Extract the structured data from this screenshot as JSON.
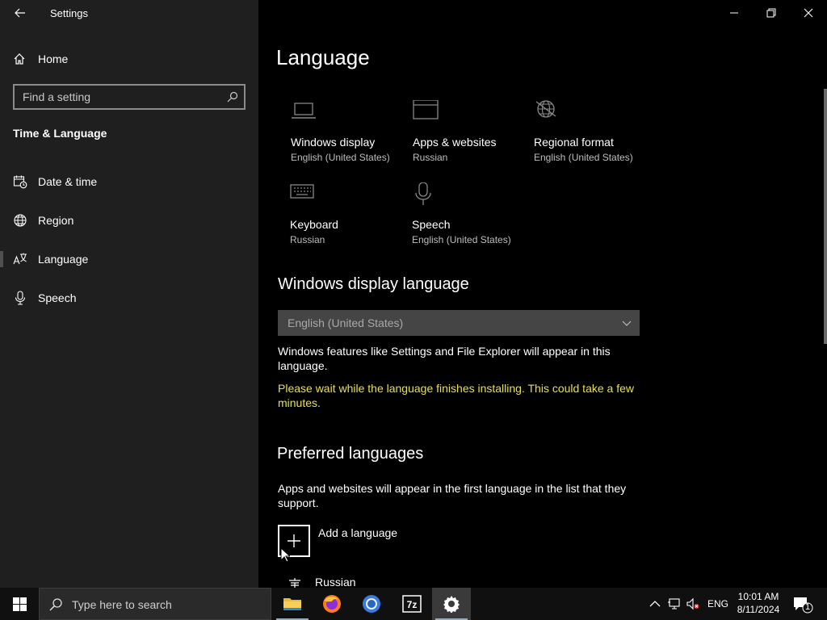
{
  "window": {
    "title": "Settings"
  },
  "sidebar": {
    "home_label": "Home",
    "search_placeholder": "Find a setting",
    "section_title": "Time & Language",
    "items": [
      {
        "label": "Date & time",
        "icon": "calendar-clock-icon"
      },
      {
        "label": "Region",
        "icon": "globe-icon"
      },
      {
        "label": "Language",
        "icon": "language-icon",
        "selected": true
      },
      {
        "label": "Speech",
        "icon": "microphone-icon"
      }
    ]
  },
  "main": {
    "title": "Language",
    "tiles": [
      {
        "name": "Windows display",
        "value": "English (United States)",
        "icon": "laptop-icon"
      },
      {
        "name": "Apps & websites",
        "value": "Russian",
        "icon": "browser-window-icon"
      },
      {
        "name": "Regional format",
        "value": "English (United States)",
        "icon": "regional-globe-icon"
      },
      {
        "name": "Keyboard",
        "value": "Russian",
        "icon": "keyboard-icon"
      },
      {
        "name": "Speech",
        "value": "English (United States)",
        "icon": "microphone-icon"
      }
    ],
    "display_language": {
      "heading": "Windows display language",
      "selected": "English (United States)",
      "description": "Windows features like Settings and File Explorer will appear in this language.",
      "warning": "Please wait while the language finishes installing. This could take a few minutes.",
      "warning_color": "#e8e04a"
    },
    "preferred": {
      "heading": "Preferred languages",
      "description": "Apps and websites will appear in the first language in the list that they support.",
      "add_label": "Add a language",
      "languages": [
        "Russian"
      ]
    }
  },
  "taskbar": {
    "search_placeholder": "Type here to search",
    "apps": [
      {
        "name": "File Explorer",
        "icon": "folder-icon"
      },
      {
        "name": "Firefox",
        "icon": "firefox-icon"
      },
      {
        "name": "Chromium",
        "icon": "chromium-icon"
      },
      {
        "name": "7-Zip",
        "icon": "7zip-icon",
        "text": "7z"
      },
      {
        "name": "Settings",
        "icon": "gear-icon",
        "active": true
      }
    ],
    "tray": {
      "language": "ENG",
      "time": "10:01 AM",
      "date": "8/11/2024",
      "notification_count": "1"
    }
  }
}
